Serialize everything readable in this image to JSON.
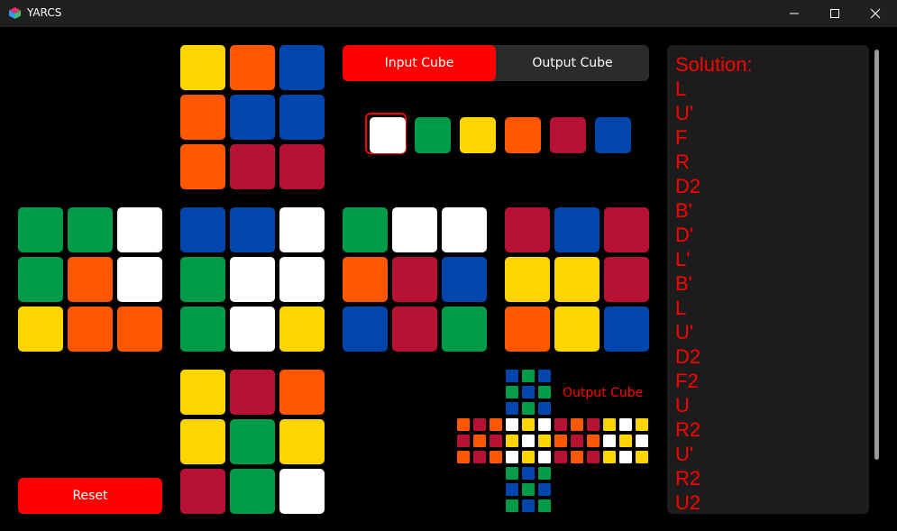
{
  "window": {
    "title": "YARCS"
  },
  "tabs": {
    "input_label": "Input Cube",
    "output_label": "Output Cube"
  },
  "reset_label": "Reset",
  "output_cube_label": "Output Cube",
  "colors": {
    "W": "#ffffff",
    "G": "#009b48",
    "Y": "#ffd500",
    "O": "#ff5800",
    "R": "#b71234",
    "B": "#0046ad",
    "accent": "#ff0000",
    "solution_text": "#ff0000"
  },
  "palette": [
    "W",
    "G",
    "Y",
    "O",
    "R",
    "B"
  ],
  "selected_palette_index": 0,
  "input_cube": {
    "U": [
      "Y",
      "O",
      "B",
      "O",
      "B",
      "B",
      "O",
      "R",
      "R"
    ],
    "L": [
      "G",
      "G",
      "W",
      "G",
      "O",
      "W",
      "Y",
      "O",
      "O"
    ],
    "F": [
      "B",
      "B",
      "W",
      "G",
      "W",
      "W",
      "G",
      "W",
      "Y"
    ],
    "R": [
      "G",
      "W",
      "W",
      "O",
      "R",
      "B",
      "B",
      "R",
      "G"
    ],
    "B": [
      "R",
      "B",
      "R",
      "Y",
      "Y",
      "R",
      "O",
      "Y",
      "B"
    ],
    "D": [
      "Y",
      "R",
      "O",
      "Y",
      "G",
      "Y",
      "R",
      "G",
      "W"
    ]
  },
  "output_cube": {
    "U": [
      "B",
      "G",
      "B",
      "G",
      "B",
      "G",
      "B",
      "G",
      "B"
    ],
    "L": [
      "O",
      "R",
      "O",
      "R",
      "O",
      "R",
      "O",
      "R",
      "O"
    ],
    "F": [
      "W",
      "Y",
      "W",
      "Y",
      "W",
      "Y",
      "W",
      "Y",
      "W"
    ],
    "R": [
      "R",
      "O",
      "R",
      "O",
      "R",
      "O",
      "R",
      "O",
      "R"
    ],
    "B": [
      "Y",
      "W",
      "Y",
      "W",
      "Y",
      "W",
      "Y",
      "W",
      "Y"
    ],
    "D": [
      "G",
      "B",
      "G",
      "B",
      "G",
      "B",
      "G",
      "B",
      "G"
    ]
  },
  "solution": {
    "heading": "Solution:",
    "moves": [
      "L",
      "U'",
      "F",
      "R",
      "D2",
      "B'",
      "D'",
      "L'",
      "B'",
      "L",
      "U'",
      "D2",
      "F2",
      "U",
      "R2",
      "U'",
      "R2",
      "U2"
    ]
  }
}
